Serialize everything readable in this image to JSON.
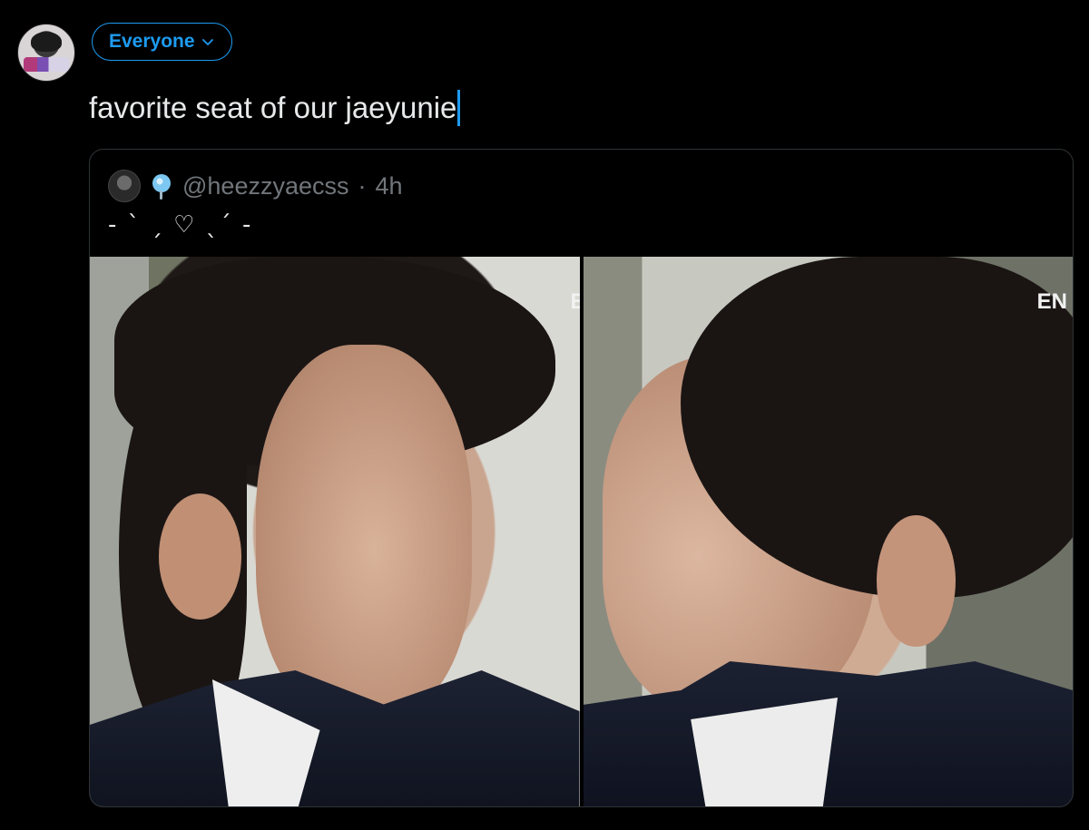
{
  "audience": {
    "label": "Everyone"
  },
  "compose": {
    "text": "favorite seat of our jaeyunie"
  },
  "quote": {
    "handle": "@heezzyaecss",
    "separator": "·",
    "time": "4h",
    "text": "- ˋ ˏ ♡ ˎˊ -"
  },
  "media": {
    "left_watermark": "E",
    "right_watermark": "EN"
  },
  "colors": {
    "accent": "#1d9bf0",
    "background": "#000000",
    "text": "#e7e9ea",
    "muted": "#71767b",
    "border": "#2f3336"
  },
  "icons": {
    "audience_chevron": "chevron-down-icon",
    "quote_emoji": "lollipop-emoji"
  }
}
